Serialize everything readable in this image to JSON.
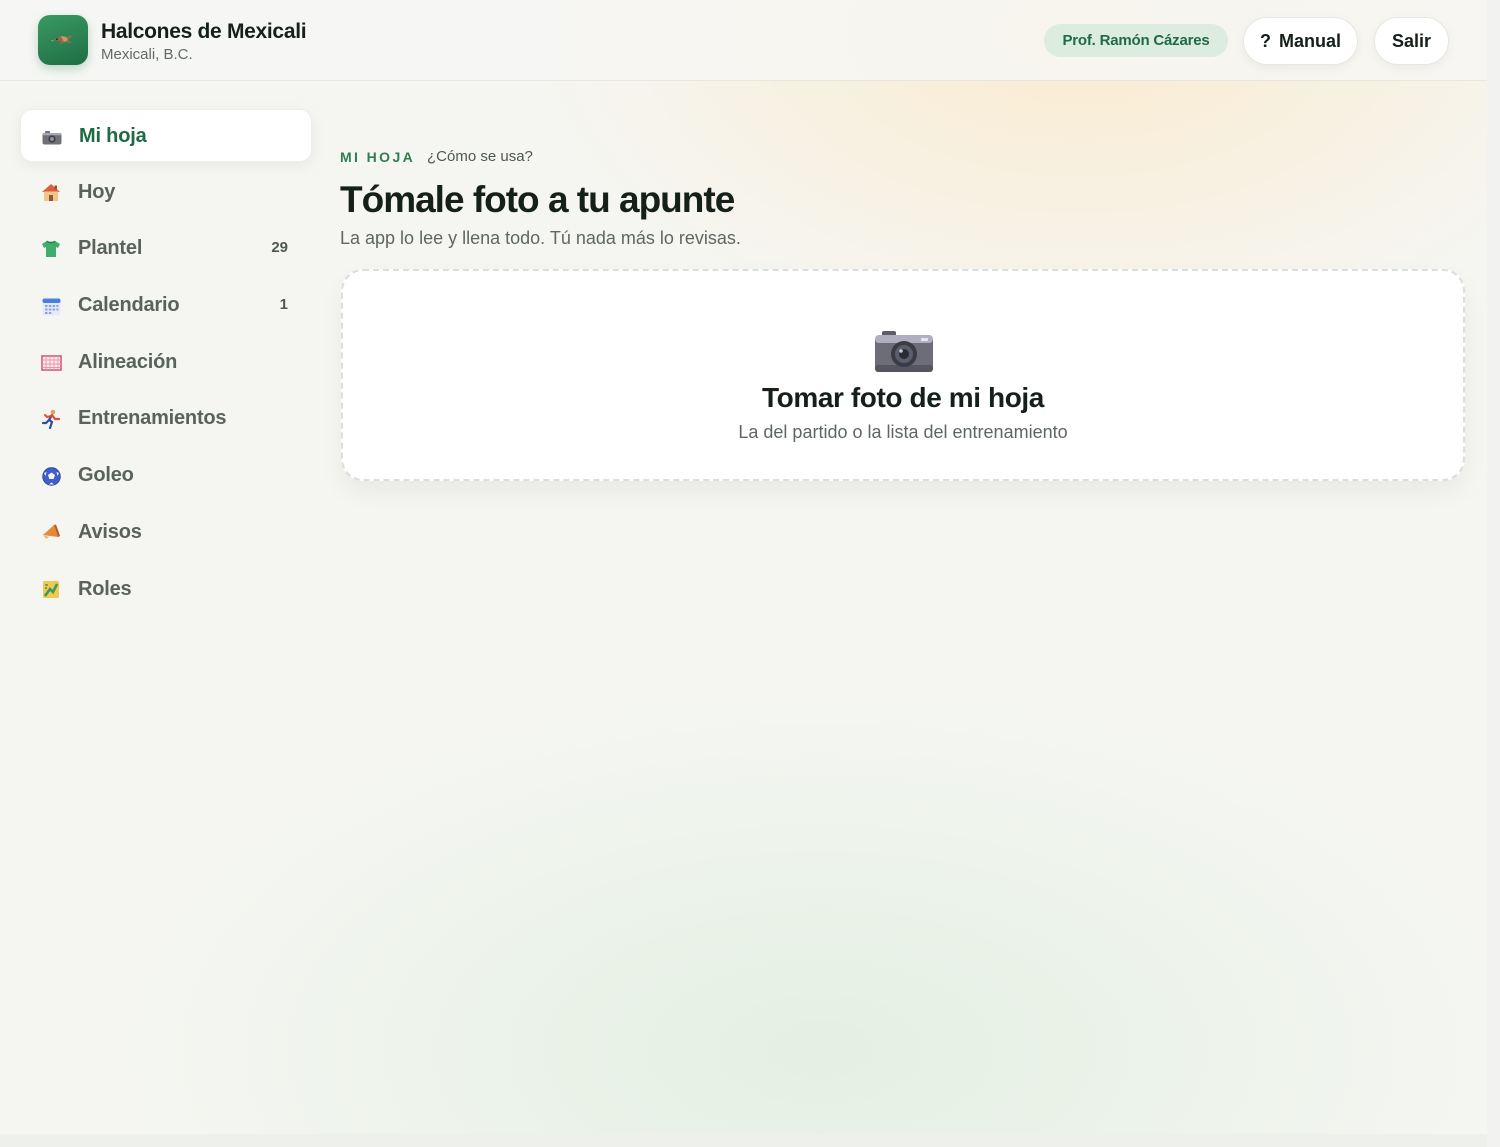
{
  "header": {
    "team_name": "Halcones de Mexicali",
    "team_city": "Mexicali, B.C.",
    "user": "Prof. Ramón Cázares",
    "manual_label": "Manual",
    "manual_prefix": "?",
    "logout_label": "Salir",
    "logo_icon": "hawk-icon"
  },
  "sidebar": {
    "items": [
      {
        "label": "Mi hoja",
        "icon": "camera-icon",
        "active": true
      },
      {
        "label": "Hoy",
        "icon": "house-icon"
      },
      {
        "label": "Plantel",
        "icon": "jersey-icon",
        "count": "29"
      },
      {
        "label": "Calendario",
        "icon": "calendar-icon",
        "count": "1"
      },
      {
        "label": "Alineación",
        "icon": "goal-net-icon"
      },
      {
        "label": "Entrenamientos",
        "icon": "runner-icon"
      },
      {
        "label": "Goleo",
        "icon": "soccer-ball-icon"
      },
      {
        "label": "Avisos",
        "icon": "megaphone-icon"
      },
      {
        "label": "Roles",
        "icon": "bracket-icon"
      }
    ]
  },
  "main": {
    "eyebrow": "MI HOJA",
    "howto_link": "¿Cómo se usa?",
    "title": "Tómale foto a tu apunte",
    "subtitle": "La app lo lee y llena todo. Tú nada más lo revisas.",
    "upload": {
      "icon": "camera-icon",
      "title": "Tomar foto de mi hoja",
      "subtitle": "La del partido o la lista del entrenamiento"
    }
  },
  "colors": {
    "brand_green": "#1f6b43",
    "chip_background": "#dcecdf",
    "logo_gradient": [
      "#3a9a62",
      "#1f6d45"
    ]
  }
}
